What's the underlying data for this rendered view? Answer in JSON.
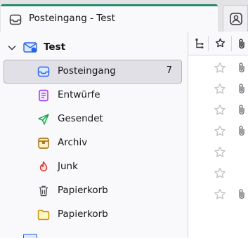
{
  "tab": {
    "title": "Posteingang - Test",
    "accent": "#2a8a6f"
  },
  "account": {
    "name": "Test",
    "expanded": true
  },
  "folders": [
    {
      "name": "Posteingang",
      "icon": "inbox-icon",
      "unread": "7",
      "selected": true
    },
    {
      "name": "Entwürfe",
      "icon": "drafts-icon"
    },
    {
      "name": "Gesendet",
      "icon": "sent-icon"
    },
    {
      "name": "Archiv",
      "icon": "archive-icon"
    },
    {
      "name": "Junk",
      "icon": "junk-icon"
    },
    {
      "name": "Papierkorb",
      "icon": "trash-icon"
    },
    {
      "name": "Papierkorb",
      "icon": "folder-icon"
    }
  ],
  "message_list": {
    "columns": [
      "thread-icon",
      "star-icon",
      "attachment-icon"
    ],
    "rows": [
      {
        "starred": false,
        "attachment": true
      },
      {
        "starred": false,
        "attachment": true
      },
      {
        "starred": false,
        "attachment": true
      },
      {
        "starred": false,
        "attachment": true
      },
      {
        "starred": false,
        "attachment": false
      },
      {
        "starred": false,
        "attachment": false
      },
      {
        "starred": false,
        "attachment": true
      }
    ]
  }
}
